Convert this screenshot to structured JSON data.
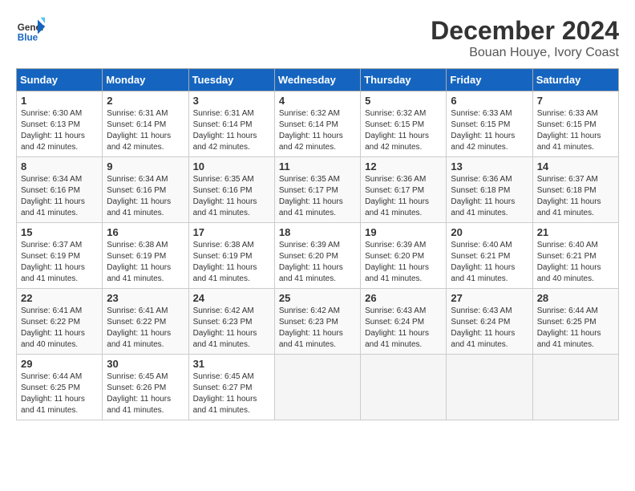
{
  "logo": {
    "line1": "General",
    "line2": "Blue"
  },
  "title": "December 2024",
  "location": "Bouan Houye, Ivory Coast",
  "days_of_week": [
    "Sunday",
    "Monday",
    "Tuesday",
    "Wednesday",
    "Thursday",
    "Friday",
    "Saturday"
  ],
  "weeks": [
    [
      {
        "day": "1",
        "sunrise": "6:30 AM",
        "sunset": "6:13 PM",
        "daylight": "11 hours and 42 minutes."
      },
      {
        "day": "2",
        "sunrise": "6:31 AM",
        "sunset": "6:14 PM",
        "daylight": "11 hours and 42 minutes."
      },
      {
        "day": "3",
        "sunrise": "6:31 AM",
        "sunset": "6:14 PM",
        "daylight": "11 hours and 42 minutes."
      },
      {
        "day": "4",
        "sunrise": "6:32 AM",
        "sunset": "6:14 PM",
        "daylight": "11 hours and 42 minutes."
      },
      {
        "day": "5",
        "sunrise": "6:32 AM",
        "sunset": "6:15 PM",
        "daylight": "11 hours and 42 minutes."
      },
      {
        "day": "6",
        "sunrise": "6:33 AM",
        "sunset": "6:15 PM",
        "daylight": "11 hours and 42 minutes."
      },
      {
        "day": "7",
        "sunrise": "6:33 AM",
        "sunset": "6:15 PM",
        "daylight": "11 hours and 41 minutes."
      }
    ],
    [
      {
        "day": "8",
        "sunrise": "6:34 AM",
        "sunset": "6:16 PM",
        "daylight": "11 hours and 41 minutes."
      },
      {
        "day": "9",
        "sunrise": "6:34 AM",
        "sunset": "6:16 PM",
        "daylight": "11 hours and 41 minutes."
      },
      {
        "day": "10",
        "sunrise": "6:35 AM",
        "sunset": "6:16 PM",
        "daylight": "11 hours and 41 minutes."
      },
      {
        "day": "11",
        "sunrise": "6:35 AM",
        "sunset": "6:17 PM",
        "daylight": "11 hours and 41 minutes."
      },
      {
        "day": "12",
        "sunrise": "6:36 AM",
        "sunset": "6:17 PM",
        "daylight": "11 hours and 41 minutes."
      },
      {
        "day": "13",
        "sunrise": "6:36 AM",
        "sunset": "6:18 PM",
        "daylight": "11 hours and 41 minutes."
      },
      {
        "day": "14",
        "sunrise": "6:37 AM",
        "sunset": "6:18 PM",
        "daylight": "11 hours and 41 minutes."
      }
    ],
    [
      {
        "day": "15",
        "sunrise": "6:37 AM",
        "sunset": "6:19 PM",
        "daylight": "11 hours and 41 minutes."
      },
      {
        "day": "16",
        "sunrise": "6:38 AM",
        "sunset": "6:19 PM",
        "daylight": "11 hours and 41 minutes."
      },
      {
        "day": "17",
        "sunrise": "6:38 AM",
        "sunset": "6:19 PM",
        "daylight": "11 hours and 41 minutes."
      },
      {
        "day": "18",
        "sunrise": "6:39 AM",
        "sunset": "6:20 PM",
        "daylight": "11 hours and 41 minutes."
      },
      {
        "day": "19",
        "sunrise": "6:39 AM",
        "sunset": "6:20 PM",
        "daylight": "11 hours and 41 minutes."
      },
      {
        "day": "20",
        "sunrise": "6:40 AM",
        "sunset": "6:21 PM",
        "daylight": "11 hours and 41 minutes."
      },
      {
        "day": "21",
        "sunrise": "6:40 AM",
        "sunset": "6:21 PM",
        "daylight": "11 hours and 40 minutes."
      }
    ],
    [
      {
        "day": "22",
        "sunrise": "6:41 AM",
        "sunset": "6:22 PM",
        "daylight": "11 hours and 40 minutes."
      },
      {
        "day": "23",
        "sunrise": "6:41 AM",
        "sunset": "6:22 PM",
        "daylight": "11 hours and 41 minutes."
      },
      {
        "day": "24",
        "sunrise": "6:42 AM",
        "sunset": "6:23 PM",
        "daylight": "11 hours and 41 minutes."
      },
      {
        "day": "25",
        "sunrise": "6:42 AM",
        "sunset": "6:23 PM",
        "daylight": "11 hours and 41 minutes."
      },
      {
        "day": "26",
        "sunrise": "6:43 AM",
        "sunset": "6:24 PM",
        "daylight": "11 hours and 41 minutes."
      },
      {
        "day": "27",
        "sunrise": "6:43 AM",
        "sunset": "6:24 PM",
        "daylight": "11 hours and 41 minutes."
      },
      {
        "day": "28",
        "sunrise": "6:44 AM",
        "sunset": "6:25 PM",
        "daylight": "11 hours and 41 minutes."
      }
    ],
    [
      {
        "day": "29",
        "sunrise": "6:44 AM",
        "sunset": "6:25 PM",
        "daylight": "11 hours and 41 minutes."
      },
      {
        "day": "30",
        "sunrise": "6:45 AM",
        "sunset": "6:26 PM",
        "daylight": "11 hours and 41 minutes."
      },
      {
        "day": "31",
        "sunrise": "6:45 AM",
        "sunset": "6:27 PM",
        "daylight": "11 hours and 41 minutes."
      },
      null,
      null,
      null,
      null
    ]
  ]
}
